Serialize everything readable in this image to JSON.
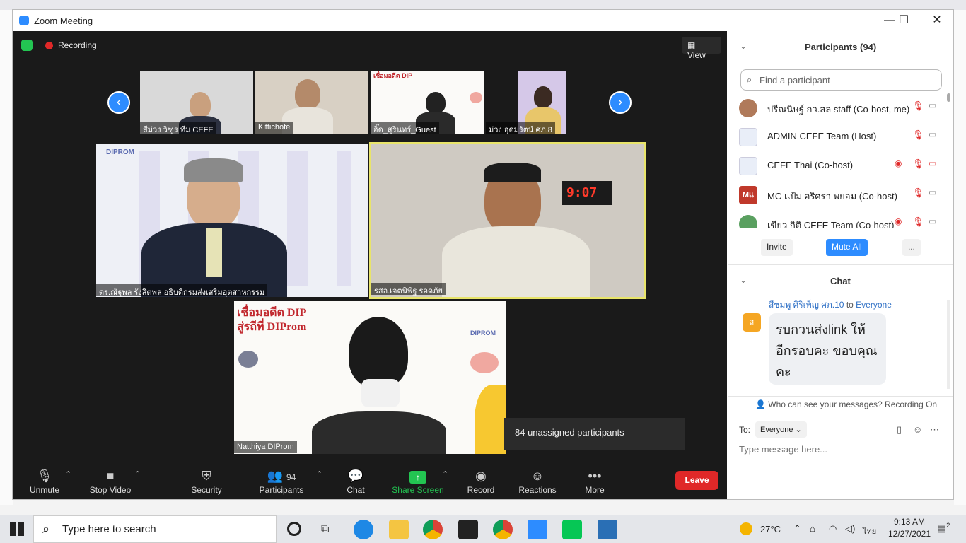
{
  "window": {
    "title": "Zoom Meeting",
    "minimize": "—",
    "maximize": "☐",
    "close": "✕"
  },
  "meeting": {
    "recording_label": "Recording",
    "view_label": "View",
    "gallery": [
      {
        "name": "สีม่วง วิฑูร ทีม CEFE"
      },
      {
        "name": "Kittichote"
      },
      {
        "name": "อิ๊ด_สุรินทร์_Guest"
      },
      {
        "name": "ม่วง อุดมรัตน์ ศภ.8"
      }
    ],
    "main_tiles": [
      {
        "name": "ดร.ณัฐพล รังสิตพล อธิบดีกรมส่งเสริมอุตสาหกรรม"
      },
      {
        "name": "รสอ.เจตนิพิฐ รอดภัย"
      },
      {
        "name": "Natthiya DIProm"
      }
    ],
    "banner_line1": "เชื่อมอดีต DIP",
    "banner_line2": "สู่รถีที่ DIProm",
    "logo_text": "DIPROM",
    "clock": "9:07",
    "tooltip": "84 unassigned participants"
  },
  "toolbar": {
    "unmute": "Unmute",
    "stop_video": "Stop Video",
    "security": "Security",
    "participants": "Participants",
    "participants_count": "94",
    "chat": "Chat",
    "share_screen": "Share Screen",
    "record": "Record",
    "reactions": "Reactions",
    "more": "More",
    "leave": "Leave"
  },
  "participants_panel": {
    "title": "Participants (94)",
    "search_placeholder": "Find a participant",
    "rows": [
      {
        "name": "ปรีณนิษฐ์ กว.สล staff (Co-host, me)"
      },
      {
        "name": "ADMIN CEFE Team (Host)"
      },
      {
        "name": "CEFE Thai (Co-host)"
      },
      {
        "name": "MC แป้ม อริศรา พยอม (Co-host)"
      },
      {
        "name": "เขียว กิติ CEFE Team (Co-host)"
      }
    ],
    "mc_avatar": "Mแ",
    "invite": "Invite",
    "mute_all": "Mute All",
    "more": "..."
  },
  "chat": {
    "title": "Chat",
    "sender": "สีชมพู ศิริเพ็ญ ศภ.10",
    "to_word": "to",
    "recipient": "Everyone",
    "avatar_letter": "ส",
    "message": "รบกวนส่งlink ให้อีกรอบคะ ขอบคุณคะ",
    "notice": "Who can see your messages? Recording On",
    "to_label": "To:",
    "to_value": "Everyone",
    "input_placeholder": "Type message here..."
  },
  "taskbar": {
    "search_placeholder": "Type here to search",
    "temperature": "27°C",
    "language": "ไทย",
    "time": "9:13 AM",
    "date": "12/27/2021",
    "notification_count": "2"
  },
  "colors": {
    "accent": "#2d8cff",
    "danger": "#e02828",
    "active_speaker": "#e8e46a",
    "share_green": "#23c552"
  }
}
